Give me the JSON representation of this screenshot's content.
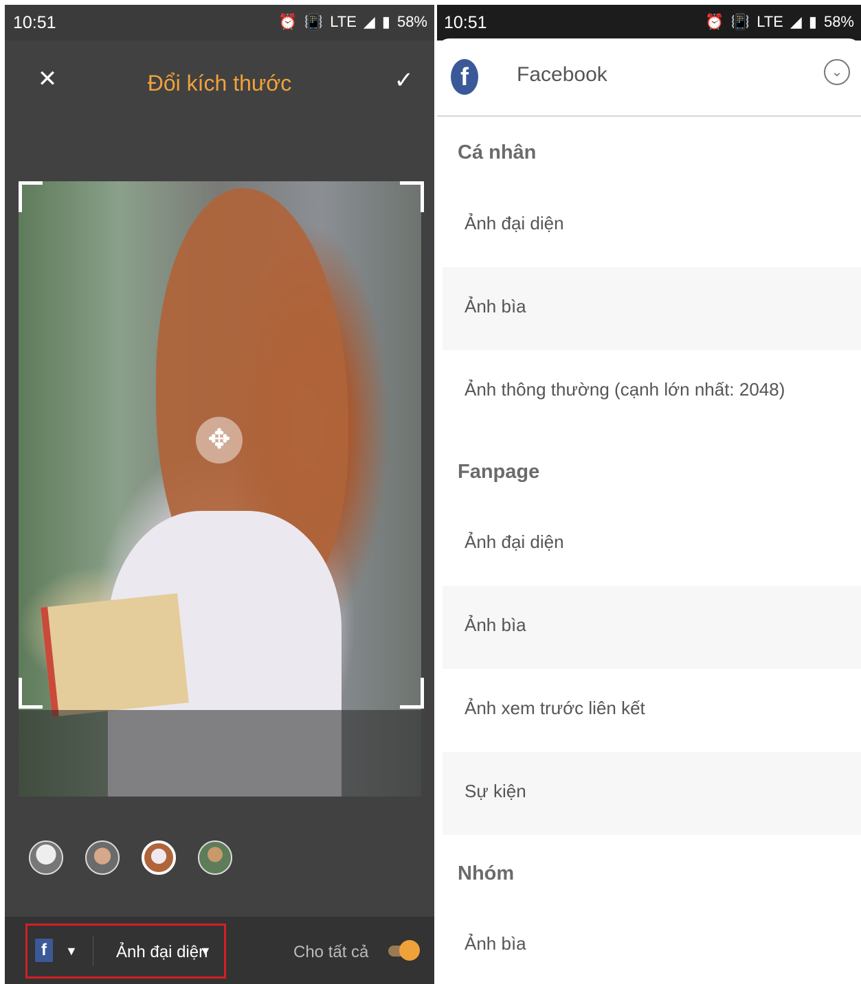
{
  "left": {
    "status": {
      "time": "10:51",
      "icons": [
        "alarm-icon",
        "vibrate-icon",
        "LTE",
        "signal-icon",
        "battery-icon"
      ],
      "lte": "LTE",
      "battery": "58%"
    },
    "toolbar": {
      "title": "Đổi kích thước",
      "close_icon": "close-icon",
      "confirm_icon": "check-icon"
    },
    "thumbnails": [
      {
        "selected": false
      },
      {
        "selected": false
      },
      {
        "selected": true
      },
      {
        "selected": false
      }
    ],
    "bottom": {
      "size_label": "Ảnh đại diện",
      "for_all_label": "Cho tất cả",
      "for_all_enabled": true
    },
    "colors": {
      "accent": "#f0a23a",
      "highlight": "#d41f26",
      "facebook": "#3b5998"
    }
  },
  "right": {
    "status": {
      "time": "10:51",
      "lte": "LTE",
      "battery": "58%"
    },
    "header": {
      "app": "Facebook"
    },
    "sections": [
      {
        "title": "Cá nhân",
        "items": [
          "Ảnh đại diện",
          "Ảnh bìa",
          "Ảnh thông thường (cạnh lớn nhất: 2048)"
        ]
      },
      {
        "title": "Fanpage",
        "items": [
          "Ảnh đại diện",
          "Ảnh bìa",
          "Ảnh xem trước liên kết",
          "Sự kiện"
        ]
      },
      {
        "title": "Nhóm",
        "items": [
          "Ảnh bìa"
        ]
      }
    ]
  }
}
